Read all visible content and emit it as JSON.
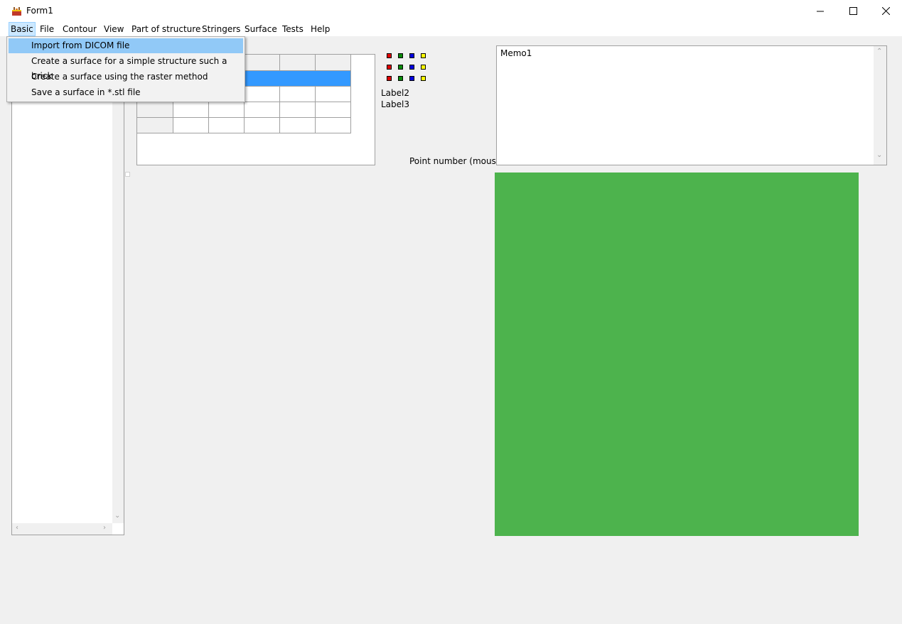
{
  "window": {
    "title": "Form1",
    "minimize": "—",
    "maximize": "☐",
    "close": "✕"
  },
  "menubar": {
    "items": [
      "Basic",
      "File",
      "Contour",
      "View",
      "Part of structure",
      "Stringers",
      "Surface",
      "Tests",
      "Help"
    ]
  },
  "dropdown": {
    "items": [
      "Import from DICOM file",
      "Create a surface for a simple structure such a brick",
      "Create a surface using the raster method",
      "Save a surface in *.stl file"
    ]
  },
  "labels": {
    "label2": "Label2",
    "label3": "Label3",
    "point_number": "Point number (mouse)"
  },
  "memo": {
    "text": "Memo1"
  },
  "colors": {
    "red": "#e00000",
    "green": "#0a8a0a",
    "blue": "#0000e0",
    "yellow": "#ffff00",
    "image": "#4db34d",
    "selection": "#3399ff"
  },
  "icons": {
    "app": "app-icon",
    "scroll_up": "chevron-up-icon",
    "scroll_down": "chevron-down-icon",
    "scroll_left": "chevron-left-icon",
    "scroll_right": "chevron-right-icon"
  }
}
